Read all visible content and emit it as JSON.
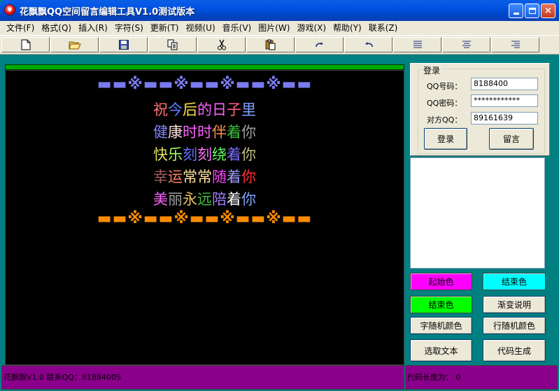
{
  "window": {
    "title": "花飘飘QQ空间留言编辑工具V1.0测试版本",
    "minimize_label": "",
    "maximize_label": "",
    "close_label": "×"
  },
  "menu": [
    "文件(F)",
    "格式(Q)",
    "插入(R)",
    "字符(S)",
    "更新(T)",
    "视频(U)",
    "音乐(V)",
    "图片(W)",
    "游戏(X)",
    "帮助(Y)",
    "联系(Z)"
  ],
  "toolbar": {
    "icons": [
      "new-file-icon",
      "open-folder-icon",
      "save-icon",
      "copy-icon",
      "cut-icon",
      "paste-icon",
      "redo-icon",
      "undo-icon",
      "align-left-icon",
      "align-center-icon",
      "align-right-icon"
    ]
  },
  "editor": {
    "deco_top": "▬▬※▬▬※▬▬※▬▬※▬▬",
    "deco_bottom": "▬▬※▬▬※▬▬※▬▬※▬▬",
    "deco_top_color": "#7b7bf0",
    "deco_bottom_color": "#ff8c00",
    "lines": [
      [
        {
          "ch": "祝",
          "color": "#ff7070"
        },
        {
          "ch": "今",
          "color": "#6080ff"
        },
        {
          "ch": "后",
          "color": "#ffe040"
        },
        {
          "ch": "的",
          "color": "#ff60ff"
        },
        {
          "ch": "日",
          "color": "#ff60ff"
        },
        {
          "ch": "子",
          "color": "#ff6080"
        },
        {
          "ch": "里",
          "color": "#80a0ff"
        }
      ],
      [
        {
          "ch": "健",
          "color": "#8080ff"
        },
        {
          "ch": "康",
          "color": "#ffe0e0"
        },
        {
          "ch": "时",
          "color": "#ff60ff"
        },
        {
          "ch": "时",
          "color": "#ff60ff"
        },
        {
          "ch": "伴",
          "color": "#ff9050"
        },
        {
          "ch": "着",
          "color": "#40c040"
        },
        {
          "ch": "你",
          "color": "#a0a0a0"
        }
      ],
      [
        {
          "ch": "快",
          "color": "#e0e060"
        },
        {
          "ch": "乐",
          "color": "#a0ff60"
        },
        {
          "ch": "刻",
          "color": "#6070ff"
        },
        {
          "ch": "刻",
          "color": "#ff70ff"
        },
        {
          "ch": "绕",
          "color": "#60ff60"
        },
        {
          "ch": "着",
          "color": "#8070ff"
        },
        {
          "ch": "你",
          "color": "#c0c080"
        }
      ],
      [
        {
          "ch": "幸",
          "color": "#a06060"
        },
        {
          "ch": "运",
          "color": "#ff8060"
        },
        {
          "ch": "常",
          "color": "#ffe0a0"
        },
        {
          "ch": "常",
          "color": "#ffe0a0"
        },
        {
          "ch": "随",
          "color": "#ff40ff"
        },
        {
          "ch": "着",
          "color": "#a0a0ff"
        },
        {
          "ch": "你",
          "color": "#ff3030"
        }
      ],
      [
        {
          "ch": "美",
          "color": "#ff60ff"
        },
        {
          "ch": "丽",
          "color": "#a0a0a0"
        },
        {
          "ch": "永",
          "color": "#e0c060"
        },
        {
          "ch": "远",
          "color": "#40c040"
        },
        {
          "ch": "陪",
          "color": "#a080ff"
        },
        {
          "ch": "着",
          "color": "#ffffff"
        },
        {
          "ch": "你",
          "color": "#80a0ff"
        }
      ]
    ]
  },
  "login": {
    "group_title": "登录",
    "qq_label": "QQ号码：",
    "qq_value": "8188400",
    "pwd_label": "QQ密码：",
    "pwd_value": "************",
    "target_label": "对方QQ：",
    "target_value": "89161639",
    "login_button": "登录",
    "message_button": "留言"
  },
  "message_box": "",
  "color_buttons": {
    "start_color": {
      "label": "起始色",
      "color": "#ff00ff"
    },
    "end_color_cyan": {
      "label": "结束色",
      "color": "#00ffff"
    },
    "end_color_green": {
      "label": "结束色",
      "color": "#00ff00"
    },
    "gradient_help": "渐变说明",
    "char_random": "字随机颜色",
    "line_random": "行随机颜色",
    "select_text": "选取文本",
    "generate_code": "代码生成"
  },
  "status": {
    "left": "花飘飘V1.0 联系QQ：8188400S",
    "right": "代码长度为：  0",
    "bar_color": "#8b008b"
  }
}
